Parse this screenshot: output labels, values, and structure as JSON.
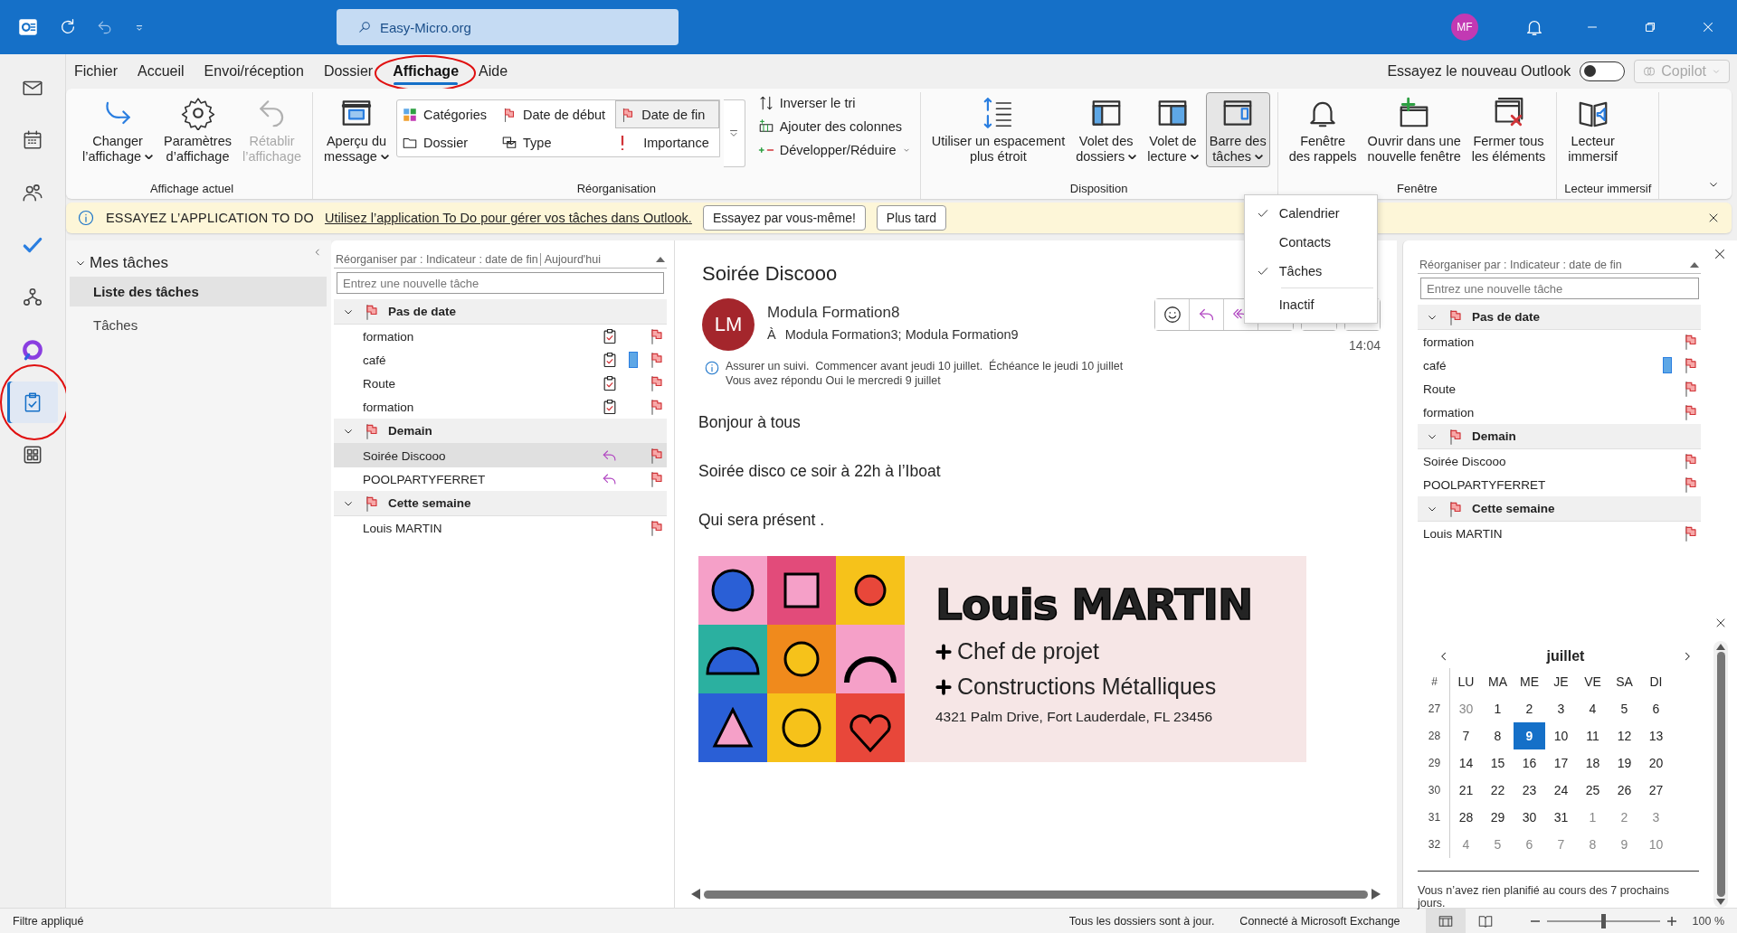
{
  "title_bar": {
    "search_text": "Easy-Micro.org",
    "avatar": "MF"
  },
  "nav": [
    {
      "selected": false
    },
    {
      "selected": false
    },
    {
      "selected": false
    },
    {
      "selected": false
    },
    {
      "selected": false
    },
    {
      "selected": false
    },
    {
      "selected": true
    },
    {
      "selected": false
    }
  ],
  "menu_tabs": [
    {
      "label": "Fichier",
      "selected": false
    },
    {
      "label": "Accueil",
      "selected": false
    },
    {
      "label": "Envoi/réception",
      "selected": false
    },
    {
      "label": "Dossier",
      "selected": false
    },
    {
      "label": "Affichage",
      "selected": true
    },
    {
      "label": "Aide",
      "selected": false
    }
  ],
  "new_outlook": {
    "label": "Essayez le nouveau Outlook",
    "on": false
  },
  "copilot": {
    "label": "Copilot",
    "disabled": true
  },
  "ribbon": {
    "groups": [
      {
        "label": "Affichage actuel",
        "buttons": [
          {
            "label": "Changer\nl’affichage",
            "dropdown": true,
            "disabled": false,
            "pressed": false
          },
          {
            "label": "Paramètres\nd’affichage",
            "dropdown": false,
            "disabled": false,
            "pressed": false
          },
          {
            "label": "Rétablir\nl’affichage",
            "dropdown": false,
            "disabled": true,
            "pressed": false
          }
        ]
      },
      {
        "label": "Réorganisation",
        "buttons": [
          {
            "label": "Aperçu du\nmessage",
            "dropdown": true,
            "disabled": false,
            "pressed": false
          }
        ],
        "gallery": [
          {
            "label": "Catégories",
            "selected": false
          },
          {
            "label": "Date de début",
            "selected": false
          },
          {
            "label": "Date de fin",
            "selected": true
          },
          {
            "label": "Dossier",
            "selected": false
          },
          {
            "label": "Type",
            "selected": false
          },
          {
            "label": "Importance",
            "selected": false
          }
        ],
        "commands": [
          {
            "label": "Inverser le tri",
            "dropdown": false
          },
          {
            "label": "Ajouter des colonnes",
            "dropdown": false
          },
          {
            "label": "Développer/Réduire",
            "dropdown": true
          }
        ]
      },
      {
        "label": "Disposition",
        "buttons": [
          {
            "label": "Utiliser un espacement\nplus étroit",
            "dropdown": false,
            "disabled": false,
            "pressed": false
          },
          {
            "label": "Volet des\ndossiers",
            "dropdown": true,
            "disabled": false,
            "pressed": false
          },
          {
            "label": "Volet de\nlecture",
            "dropdown": true,
            "disabled": false,
            "pressed": false
          },
          {
            "label": "Barre des\ntâches",
            "dropdown": true,
            "disabled": false,
            "pressed": true,
            "menu": [
              {
                "label": "Calendrier",
                "checked": true,
                "separator_before": false
              },
              {
                "label": "Contacts",
                "checked": false,
                "separator_before": false
              },
              {
                "label": "Tâches",
                "checked": true,
                "separator_before": false
              },
              {
                "label": "Inactif",
                "checked": false,
                "separator_before": true
              }
            ]
          }
        ]
      },
      {
        "label": "Fenêtre",
        "buttons": [
          {
            "label": "Fenêtre\ndes rappels",
            "dropdown": false,
            "disabled": false,
            "pressed": false
          },
          {
            "label": "Ouvrir dans une\nnouvelle fenêtre",
            "dropdown": false,
            "disabled": false,
            "pressed": false
          },
          {
            "label": "Fermer tous\nles éléments",
            "dropdown": false,
            "disabled": false,
            "pressed": false
          }
        ]
      },
      {
        "label": "Lecteur immersif",
        "buttons": [
          {
            "label": "Lecteur\nimmersif",
            "dropdown": false,
            "disabled": false,
            "pressed": false
          }
        ]
      }
    ]
  },
  "banner": {
    "title": "ESSAYEZ L’APPLICATION TO DO",
    "link": "Utilisez l’application To Do pour gérer vos tâches dans Outlook.",
    "buttons": [
      "Essayez par vous-même!",
      "Plus tard"
    ]
  },
  "folder_pane": {
    "header": "Mes tâches",
    "expanded": true,
    "items": [
      {
        "label": "Liste des tâches",
        "selected": true
      },
      {
        "label": "Tâches",
        "selected": false
      }
    ]
  },
  "task_list": {
    "sort_label": "Réorganiser par : Indicateur : date de fin",
    "sort_value": "Aujourd'hui",
    "new_task_placeholder": "Entrez une nouvelle tâche",
    "groups": [
      {
        "label": "Pas de date",
        "expanded": true,
        "items": [
          {
            "subject": "formation",
            "kind": "task",
            "selected": false
          },
          {
            "subject": "café",
            "kind": "task",
            "selected": false,
            "color": "#5ea7e6"
          },
          {
            "subject": "Route",
            "kind": "task",
            "selected": false
          },
          {
            "subject": "formation",
            "kind": "task",
            "selected": false
          }
        ]
      },
      {
        "label": "Demain",
        "expanded": true,
        "items": [
          {
            "subject": "Soirée Discooo",
            "kind": "replied",
            "selected": true
          },
          {
            "subject": "POOLPARTYFERRET",
            "kind": "replied",
            "selected": false
          }
        ]
      },
      {
        "label": "Cette semaine",
        "expanded": true,
        "items": [
          {
            "subject": "Louis MARTIN",
            "kind": "plain",
            "selected": false
          }
        ]
      }
    ]
  },
  "reading": {
    "subject": "Soirée Discooo",
    "initials": "LM",
    "sender": "Modula Formation8",
    "to_label": "À",
    "recipients": "Modula Formation3; Modula Formation9",
    "time": "14:04",
    "info": [
      "Assurer un suivi.  Commencer avant jeudi 10 juillet.  Échéance le jeudi 10 juillet",
      "Vous avez répondu Oui le mercredi 9 juillet"
    ],
    "body": [
      "Bonjour à tous",
      "Soirée disco ce soir à 22h à l’Iboat",
      "Qui sera présent ."
    ],
    "signature": {
      "name": "Louis MARTIN",
      "lines": [
        "Chef de projet",
        "Constructions Métalliques"
      ],
      "address": "4321 Palm Drive, Fort Lauderdale, FL 23456"
    }
  },
  "todo_bar": {
    "sort_label": "Réorganiser par : Indicateur : date de fin",
    "new_task_placeholder": "Entrez une nouvelle tâche",
    "groups": [
      {
        "label": "Pas de date",
        "expanded": true,
        "items": [
          {
            "subject": "formation",
            "selected": false
          },
          {
            "subject": "café",
            "selected": false,
            "color": "#5ea7e6"
          },
          {
            "subject": "Route",
            "selected": false
          },
          {
            "subject": "formation",
            "selected": false
          }
        ]
      },
      {
        "label": "Demain",
        "expanded": true,
        "items": [
          {
            "subject": "Soirée Discooo",
            "selected": false
          },
          {
            "subject": "POOLPARTYFERRET",
            "selected": false
          }
        ]
      },
      {
        "label": "Cette semaine",
        "expanded": true,
        "items": [
          {
            "subject": "Louis MARTIN",
            "selected": false
          }
        ]
      }
    ],
    "calendar": {
      "month": "juillet",
      "week_label": "#",
      "weekdays": [
        "LU",
        "MA",
        "ME",
        "JE",
        "VE",
        "SA",
        "DI"
      ],
      "weeks": [
        {
          "number": "27",
          "days": [
            {
              "day": "30",
              "muted": true,
              "selected": false
            },
            {
              "day": "1",
              "muted": false,
              "selected": false
            },
            {
              "day": "2",
              "muted": false,
              "selected": false
            },
            {
              "day": "3",
              "muted": false,
              "selected": false
            },
            {
              "day": "4",
              "muted": false,
              "selected": false
            },
            {
              "day": "5",
              "muted": false,
              "selected": false
            },
            {
              "day": "6",
              "muted": false,
              "selected": false
            }
          ]
        },
        {
          "number": "28",
          "days": [
            {
              "day": "7",
              "muted": false,
              "selected": false
            },
            {
              "day": "8",
              "muted": false,
              "selected": false
            },
            {
              "day": "9",
              "muted": false,
              "selected": true
            },
            {
              "day": "10",
              "muted": false,
              "selected": false
            },
            {
              "day": "11",
              "muted": false,
              "selected": false
            },
            {
              "day": "12",
              "muted": false,
              "selected": false
            },
            {
              "day": "13",
              "muted": false,
              "selected": false
            }
          ]
        },
        {
          "number": "29",
          "days": [
            {
              "day": "14",
              "muted": false,
              "selected": false
            },
            {
              "day": "15",
              "muted": false,
              "selected": false
            },
            {
              "day": "16",
              "muted": false,
              "selected": false
            },
            {
              "day": "17",
              "muted": false,
              "selected": false
            },
            {
              "day": "18",
              "muted": false,
              "selected": false
            },
            {
              "day": "19",
              "muted": false,
              "selected": false
            },
            {
              "day": "20",
              "muted": false,
              "selected": false
            }
          ]
        },
        {
          "number": "30",
          "days": [
            {
              "day": "21",
              "muted": false,
              "selected": false
            },
            {
              "day": "22",
              "muted": false,
              "selected": false
            },
            {
              "day": "23",
              "muted": false,
              "selected": false
            },
            {
              "day": "24",
              "muted": false,
              "selected": false
            },
            {
              "day": "25",
              "muted": false,
              "selected": false
            },
            {
              "day": "26",
              "muted": false,
              "selected": false
            },
            {
              "day": "27",
              "muted": false,
              "selected": false
            }
          ]
        },
        {
          "number": "31",
          "days": [
            {
              "day": "28",
              "muted": false,
              "selected": false
            },
            {
              "day": "29",
              "muted": false,
              "selected": false
            },
            {
              "day": "30",
              "muted": false,
              "selected": false
            },
            {
              "day": "31",
              "muted": false,
              "selected": false
            },
            {
              "day": "1",
              "muted": true,
              "selected": false
            },
            {
              "day": "2",
              "muted": true,
              "selected": false
            },
            {
              "day": "3",
              "muted": true,
              "selected": false
            }
          ]
        },
        {
          "number": "32",
          "days": [
            {
              "day": "4",
              "muted": true,
              "selected": false
            },
            {
              "day": "5",
              "muted": true,
              "selected": false
            },
            {
              "day": "6",
              "muted": true,
              "selected": false
            },
            {
              "day": "7",
              "muted": true,
              "selected": false
            },
            {
              "day": "8",
              "muted": true,
              "selected": false
            },
            {
              "day": "9",
              "muted": true,
              "selected": false
            },
            {
              "day": "10",
              "muted": true,
              "selected": false
            }
          ]
        }
      ]
    },
    "agenda_note": "Vous n’avez rien planifié au cours des 7 prochains jours."
  },
  "status_bar": {
    "filter": "Filtre appliqué",
    "sync": "Tous les dossiers sont à jour.",
    "connection": "Connecté à Microsoft Exchange",
    "zoom": {
      "level": 0.5,
      "reading": "100 %"
    }
  }
}
